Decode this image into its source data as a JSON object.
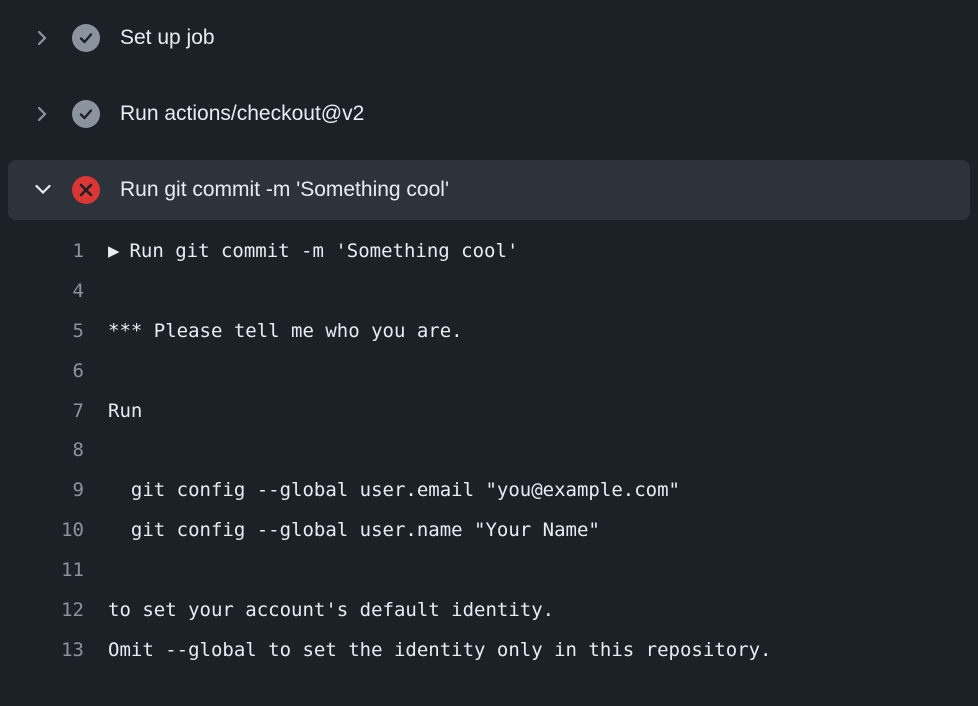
{
  "steps": [
    {
      "title": "Set up job",
      "status": "success",
      "expanded": false
    },
    {
      "title": "Run actions/checkout@v2",
      "status": "success",
      "expanded": false
    },
    {
      "title": "Run git commit -m 'Something cool'",
      "status": "failure",
      "expanded": true
    }
  ],
  "log": {
    "lines": [
      {
        "n": "1",
        "text": "Run git commit -m 'Something cool'",
        "collapsible": true
      },
      {
        "n": "4",
        "text": ""
      },
      {
        "n": "5",
        "text": "*** Please tell me who you are."
      },
      {
        "n": "6",
        "text": ""
      },
      {
        "n": "7",
        "text": "Run"
      },
      {
        "n": "8",
        "text": ""
      },
      {
        "n": "9",
        "text": "  git config --global user.email \"you@example.com\""
      },
      {
        "n": "10",
        "text": "  git config --global user.name \"Your Name\""
      },
      {
        "n": "11",
        "text": ""
      },
      {
        "n": "12",
        "text": "to set your account's default identity."
      },
      {
        "n": "13",
        "text": "Omit --global to set the identity only in this repository."
      }
    ]
  }
}
